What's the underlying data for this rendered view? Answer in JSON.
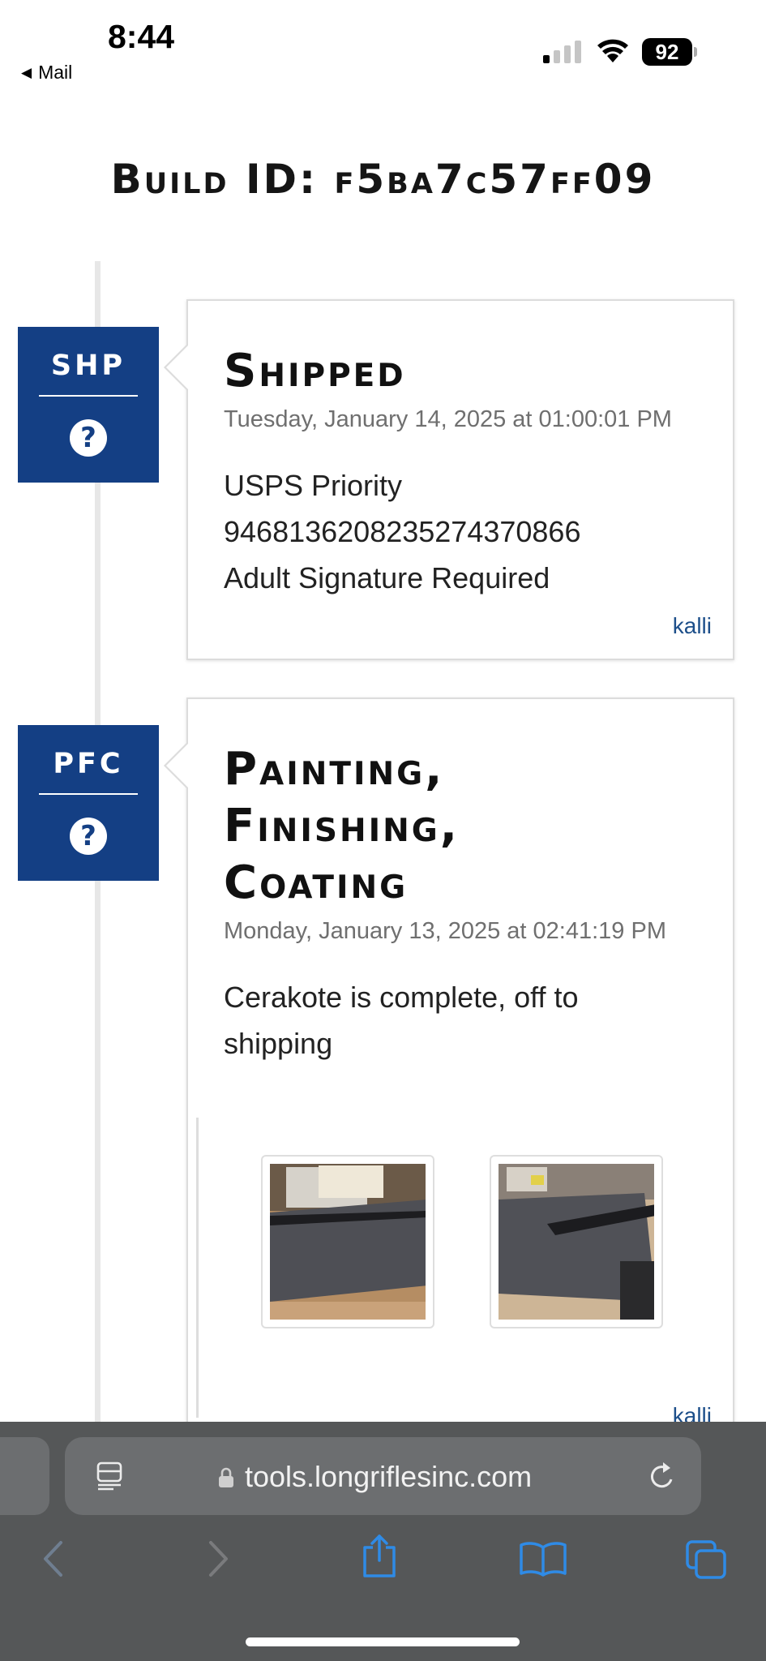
{
  "status_bar": {
    "time": "8:44",
    "back_label": "Mail",
    "battery": "92"
  },
  "page": {
    "build_title": "Build ID: f5ba7c57ff09"
  },
  "entries": [
    {
      "code": "SHP",
      "help": "?",
      "title": "Shipped",
      "date": "Tuesday, January 14, 2025 at 01:00:01 PM",
      "body_lines": [
        "USPS Priority",
        "9468136208235274370866",
        "Adult Signature Required"
      ],
      "user": "kalli"
    },
    {
      "code": "PFC",
      "help": "?",
      "title": "Painting, Finishing, Coating",
      "date": "Monday, January 13, 2025 at 02:41:19 PM",
      "body_lines": [
        "Cerakote is complete, off to shipping"
      ],
      "user": "kalli",
      "photos": [
        "photo-rifle-on-carpet",
        "photo-rifle-on-carpet-2"
      ]
    }
  ],
  "browser": {
    "url": "tools.longriflesinc.com",
    "icons": [
      "reader-icon",
      "lock-icon",
      "reload-icon",
      "back-icon",
      "forward-icon",
      "share-icon",
      "bookmarks-icon",
      "tabs-icon"
    ]
  },
  "colors": {
    "badge": "#143f84",
    "link": "#1d4f8a",
    "toolbar": "#555758",
    "toolbar_icon": "#1e7fe0"
  }
}
